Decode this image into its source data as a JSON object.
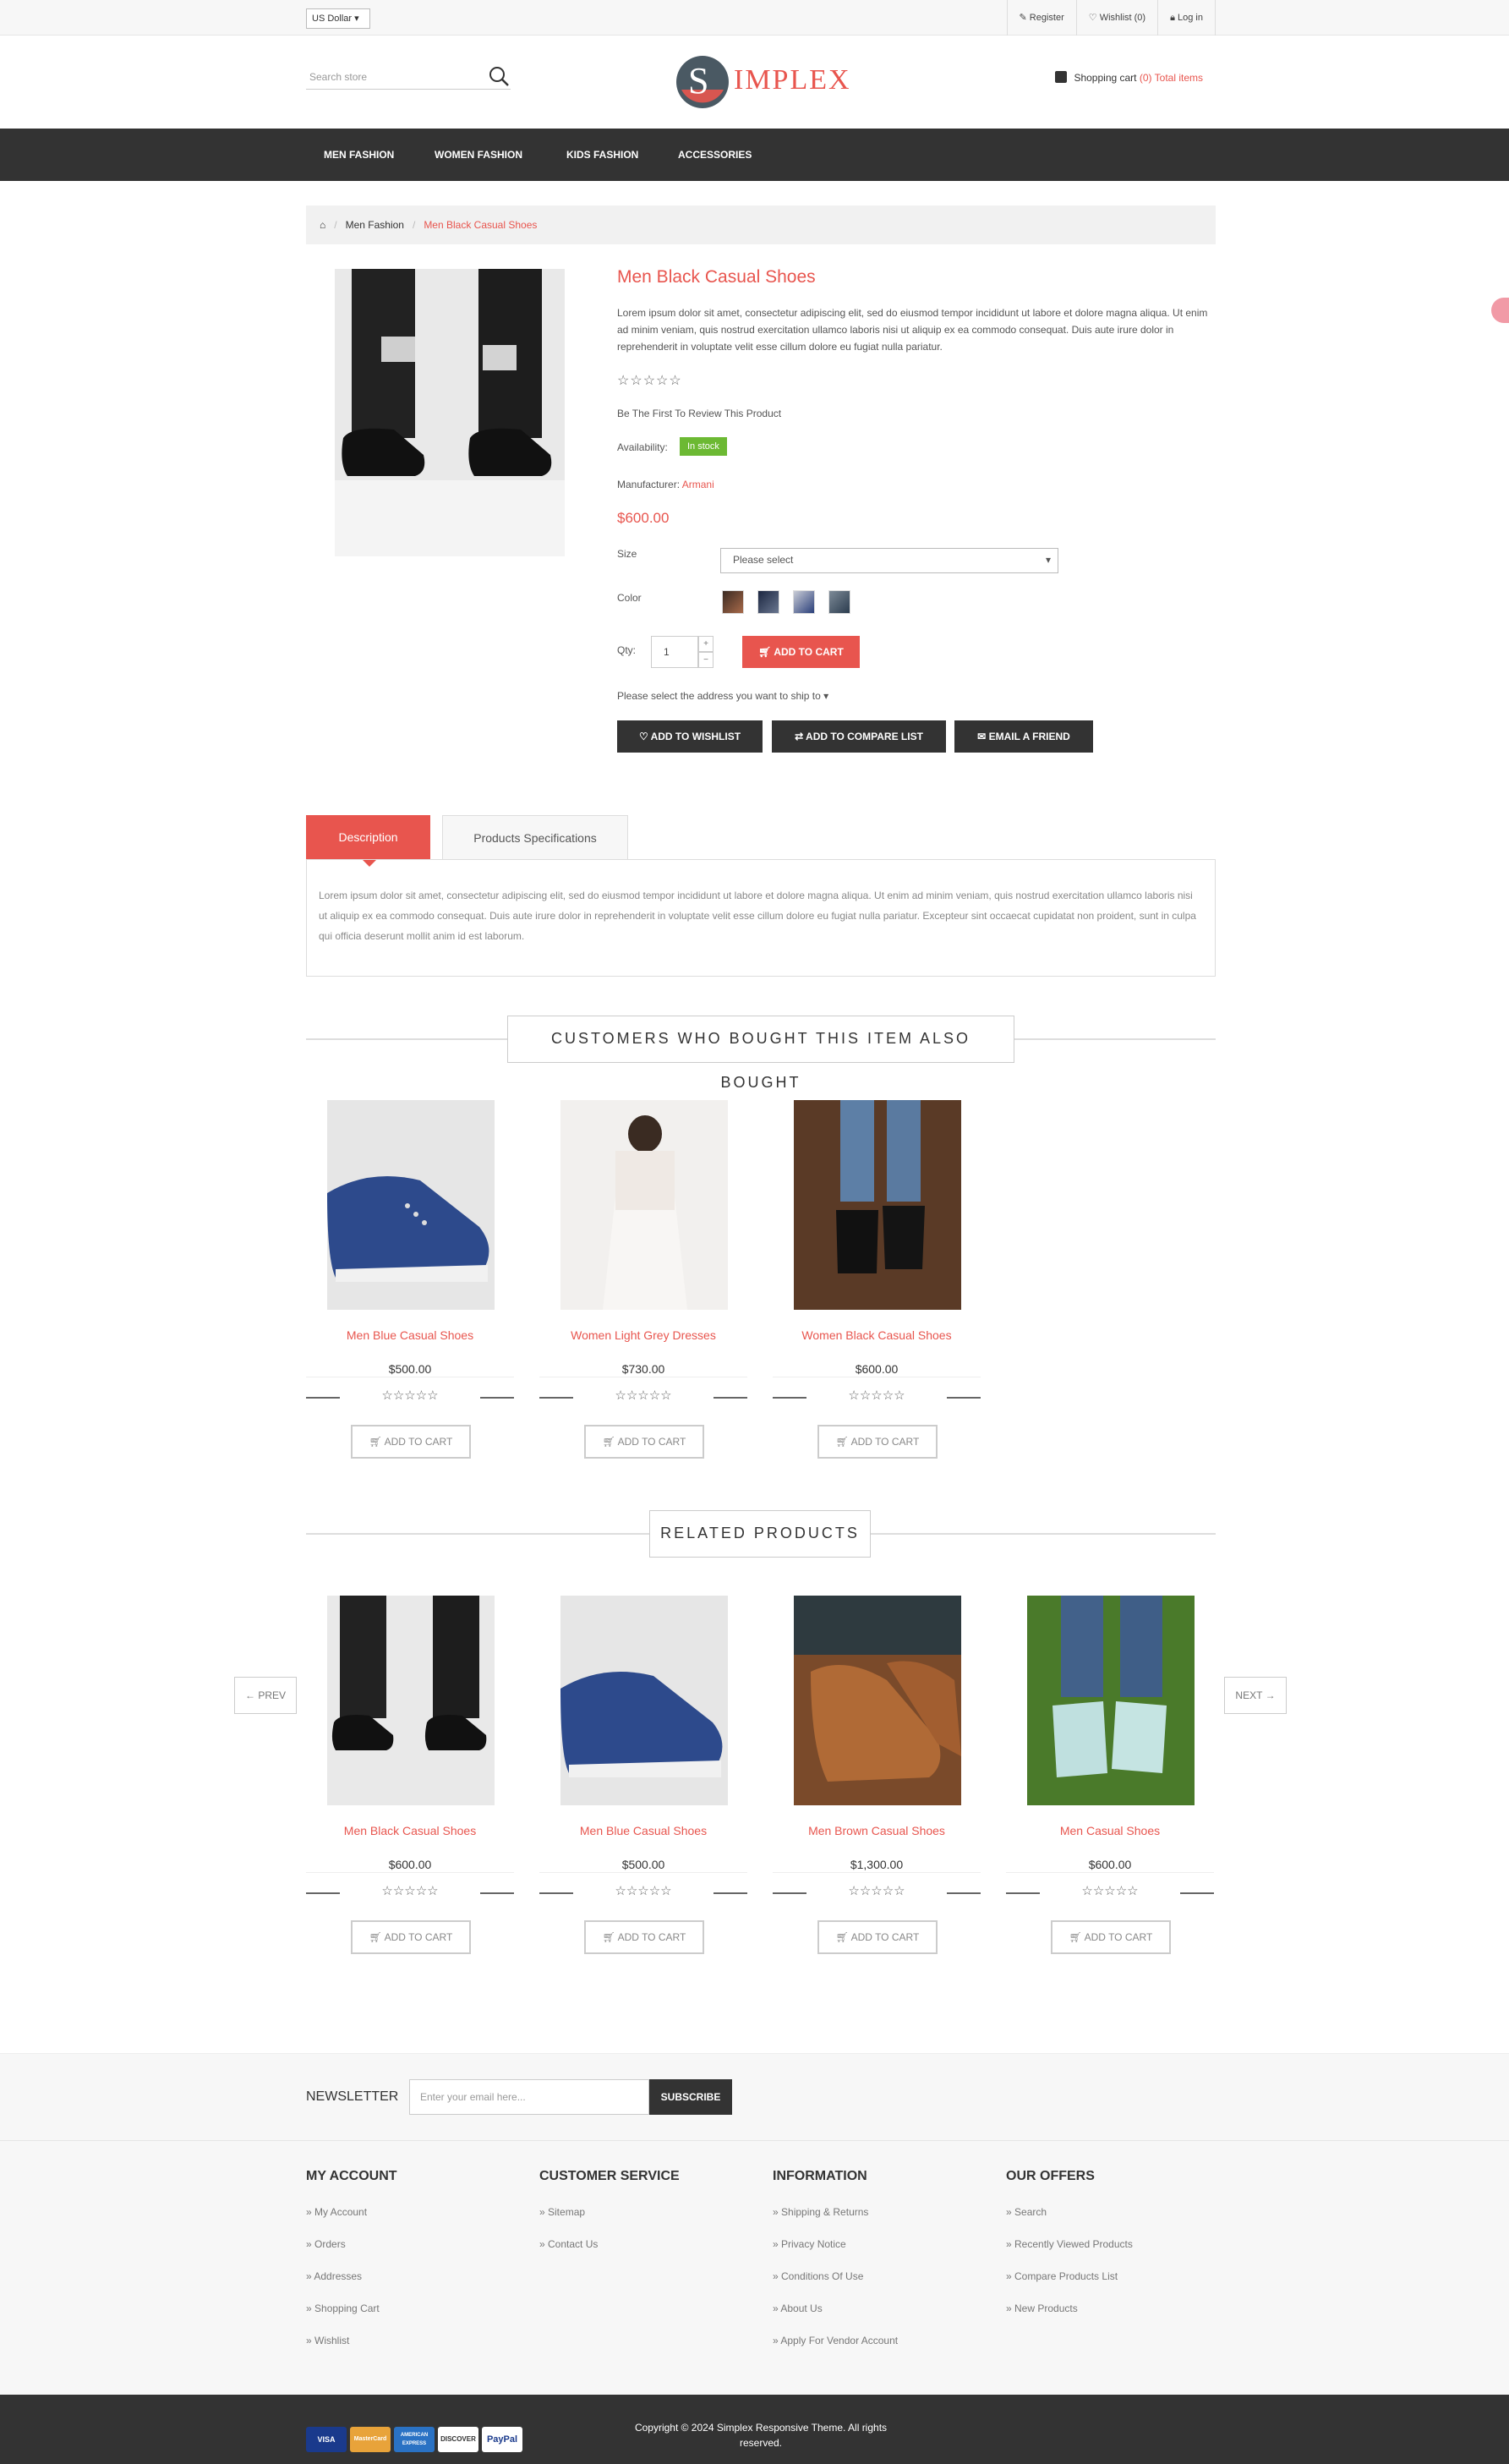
{
  "topbar": {
    "currency": "US Dollar",
    "register": "Register",
    "wishlist": "Wishlist (0)",
    "login": "Log in"
  },
  "header": {
    "search_placeholder": "Search store",
    "logo_letter": "S",
    "logo_text": "IMPLEX",
    "cart_label": "Shopping cart",
    "cart_count": "(0) Total items"
  },
  "nav": [
    "MEN FASHION",
    "WOMEN FASHION",
    "KIDS FASHION",
    "ACCESSORIES"
  ],
  "breadcrumb": {
    "section": "Men Fashion",
    "current": "Men Black Casual Shoes"
  },
  "product": {
    "title": "Men Black Casual Shoes",
    "description": "Lorem ipsum dolor sit amet, consectetur adipiscing elit, sed do eiusmod tempor incididunt ut labore et dolore magna aliqua. Ut enim ad minim veniam, quis nostrud exercitation ullamco laboris nisi ut aliquip ex ea commodo consequat. Duis aute irure dolor in reprehenderit in voluptate velit esse cillum dolore eu fugiat nulla pariatur.",
    "stars": "☆☆☆☆☆",
    "review_text": "Be The First To Review This Product",
    "availability_label": "Availability:",
    "availability_value": "In stock",
    "manufacturer_label": "Manufacturer:",
    "manufacturer_value": "Armani",
    "price": "$600.00",
    "size_label": "Size",
    "size_value": "Please select",
    "color_label": "Color",
    "qty_label": "Qty:",
    "qty_value": "1",
    "add_to_cart": "ADD TO CART",
    "ship_text": "Please select the address you want to ship to",
    "wishlist_btn": "ADD TO WISHLIST",
    "compare_btn": "ADD TO COMPARE LIST",
    "email_btn": "EMAIL A FRIEND"
  },
  "tabs": {
    "description": "Description",
    "specs": "Products Specifications",
    "content": "Lorem ipsum dolor sit amet, consectetur adipiscing elit, sed do eiusmod tempor incididunt ut labore et dolore magna aliqua. Ut enim ad minim veniam, quis nostrud exercitation ullamco laboris nisi ut aliquip ex ea commodo consequat. Duis aute irure dolor in reprehenderit in voluptate velit esse cillum dolore eu fugiat nulla pariatur. Excepteur sint occaecat cupidatat non proident, sunt in culpa qui officia deserunt mollit anim id est laborum."
  },
  "also_bought": {
    "title": "CUSTOMERS WHO BOUGHT THIS ITEM ALSO BOUGHT",
    "items": [
      {
        "name": "Men Blue Casual Shoes",
        "price": "$500.00",
        "stars": "☆☆☆☆☆",
        "button": "ADD TO CART"
      },
      {
        "name": "Women Light Grey Dresses",
        "price": "$730.00",
        "stars": "☆☆☆☆☆",
        "button": "ADD TO CART"
      },
      {
        "name": "Women Black Casual Shoes",
        "price": "$600.00",
        "stars": "☆☆☆☆☆",
        "button": "ADD TO CART"
      }
    ]
  },
  "related": {
    "title": "RELATED PRODUCTS",
    "prev": "PREV",
    "next": "NEXT",
    "items": [
      {
        "name": "Men Black Casual Shoes",
        "price": "$600.00",
        "stars": "☆☆☆☆☆",
        "button": "ADD TO CART"
      },
      {
        "name": "Men Blue Casual Shoes",
        "price": "$500.00",
        "stars": "☆☆☆☆☆",
        "button": "ADD TO CART"
      },
      {
        "name": "Men Brown Casual Shoes",
        "price": "$1,300.00",
        "stars": "☆☆☆☆☆",
        "button": "ADD TO CART"
      },
      {
        "name": "Men Casual Shoes",
        "price": "$600.00",
        "stars": "☆☆☆☆☆",
        "button": "ADD TO CART"
      }
    ]
  },
  "newsletter": {
    "label": "NEWSLETTER",
    "placeholder": "Enter your email here...",
    "button": "SUBSCRIBE"
  },
  "footer": {
    "my_account": {
      "title": "MY ACCOUNT",
      "links": [
        "My Account",
        "Orders",
        "Addresses",
        "Shopping Cart",
        "Wishlist"
      ]
    },
    "customer_service": {
      "title": "CUSTOMER SERVICE",
      "links": [
        "Sitemap",
        "Contact Us"
      ]
    },
    "information": {
      "title": "INFORMATION",
      "links": [
        "Shipping & Returns",
        "Privacy Notice",
        "Conditions Of Use",
        "About Us",
        "Apply For Vendor Account"
      ]
    },
    "our_offers": {
      "title": "OUR OFFERS",
      "links": [
        "Search",
        "Recently Viewed Products",
        "Compare Products List",
        "New Products"
      ]
    },
    "copyright_line1": "Copyright © 2024 Simplex Responsive Theme. All rights",
    "copyright_line2": "reserved.",
    "cards": [
      "VISA",
      "MasterCard",
      "AMERICAN EXPRESS",
      "DISCOVER",
      "PayPal"
    ]
  },
  "colors": {
    "accent": "#e8554e",
    "dark": "#333333",
    "stock": "#6cb933"
  }
}
